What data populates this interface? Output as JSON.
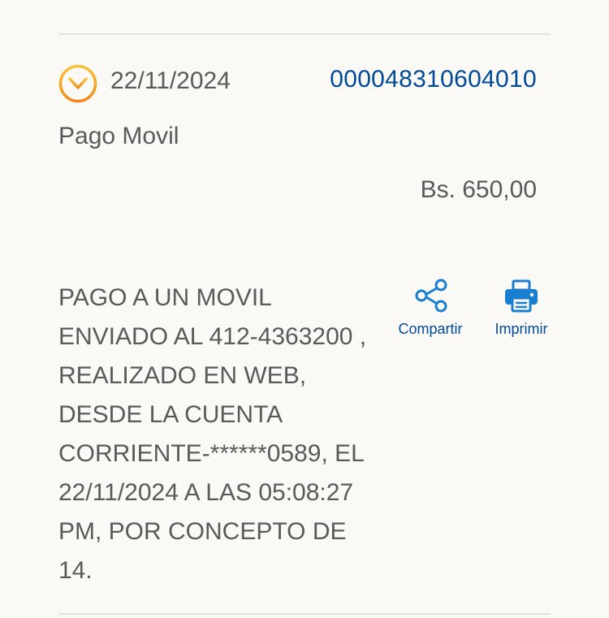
{
  "transaction": {
    "date": "22/11/2024",
    "reference": "000048310604010",
    "type": "Pago Movil",
    "amount": "Bs. 650,00",
    "description": "PAGO A UN MOVIL\nENVIADO AL 412-4363200 ,\nREALIZADO EN WEB,\nDESDE LA CUENTA\nCORRIENTE-******0589, EL\n22/11/2024 A LAS 05:08:27\nPM, POR CONCEPTO DE\n14."
  },
  "actions": {
    "share_label": "Compartir",
    "share_icon": "share-icon",
    "print_label": "Imprimir",
    "print_icon": "printer-icon"
  },
  "icons": {
    "expand": "chevron-down-circle-icon"
  },
  "colors": {
    "accent_orange": "#f5a623",
    "link_blue": "#004a98",
    "text_gray": "#5a5a5a",
    "background": "#faf9f6"
  }
}
